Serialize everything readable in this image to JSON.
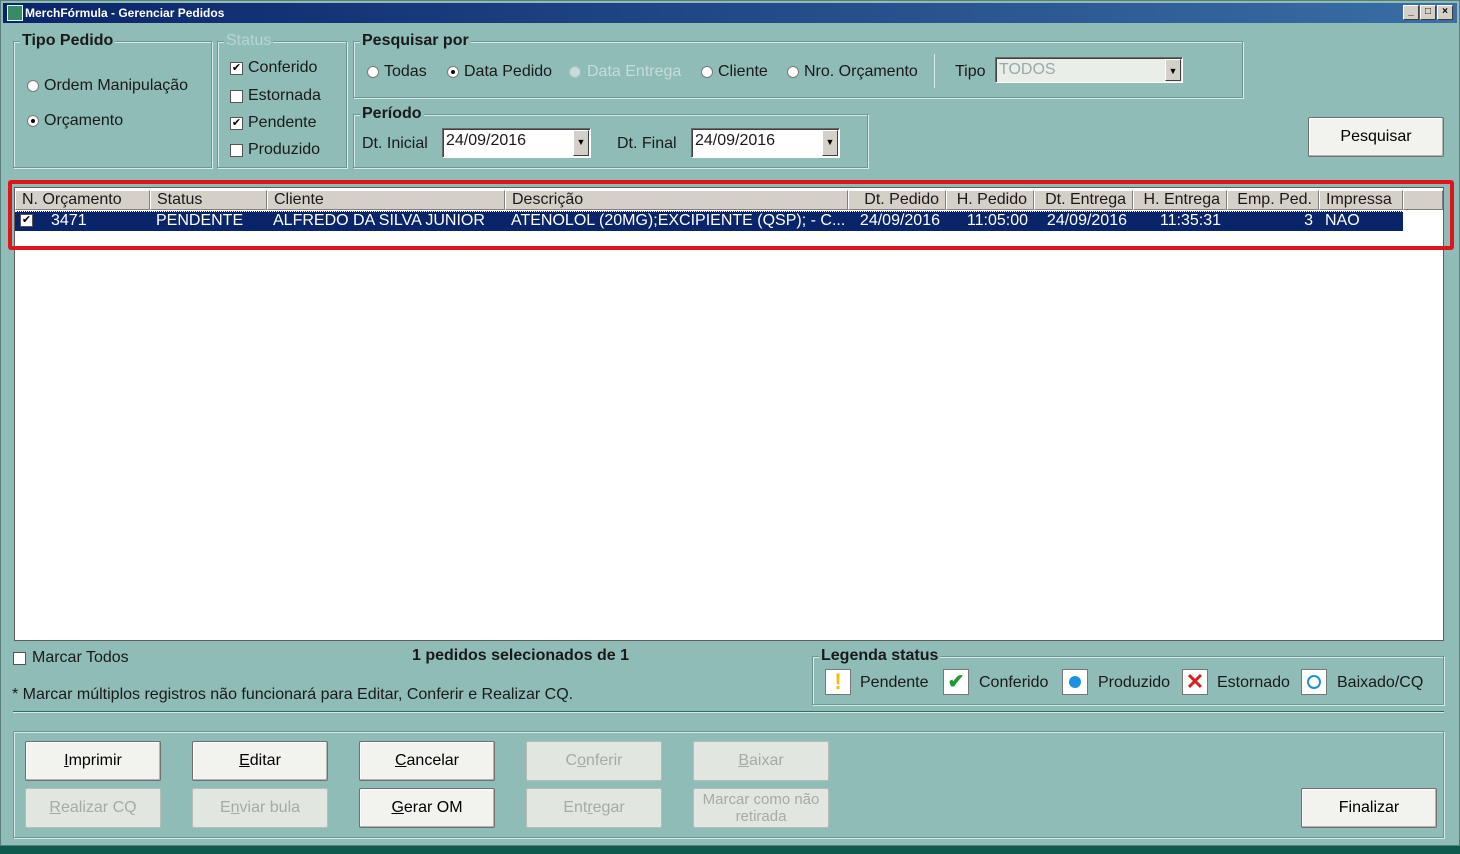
{
  "window": {
    "title": "MerchFórmula - Gerenciar Pedidos",
    "min": "_",
    "max": "□",
    "close": "×"
  },
  "tipo_pedido": {
    "title": "Tipo Pedido",
    "options": [
      {
        "label": "Ordem Manipulação",
        "selected": false
      },
      {
        "label": "Orçamento",
        "selected": true
      }
    ]
  },
  "status": {
    "title": "Status",
    "options": [
      {
        "label": "Conferido",
        "checked": true
      },
      {
        "label": "Estornada",
        "checked": false
      },
      {
        "label": "Pendente",
        "checked": true
      },
      {
        "label": "Produzido",
        "checked": false
      }
    ]
  },
  "pesquisar_por": {
    "title": "Pesquisar por",
    "options": [
      {
        "label": "Todas",
        "selected": false
      },
      {
        "label": "Data Pedido",
        "selected": true
      },
      {
        "label": "Data Entrega",
        "selected": false,
        "disabled": true
      },
      {
        "label": "Cliente",
        "selected": false
      },
      {
        "label": "Nro. Orçamento",
        "selected": false
      }
    ],
    "tipo_label": "Tipo",
    "tipo_value": "TODOS"
  },
  "periodo": {
    "title": "Período",
    "dt_inicial_label": "Dt. Inicial",
    "dt_inicial": "24/09/2016",
    "dt_final_label": "Dt. Final",
    "dt_final": "24/09/2016"
  },
  "pesquisar_button": "Pesquisar",
  "grid": {
    "columns": [
      "N. Orçamento",
      "Status",
      "Cliente",
      "Descrição",
      "Dt. Pedido",
      "H. Pedido",
      "Dt. Entrega",
      "H. Entrega",
      "Emp. Ped.",
      "Impressa"
    ],
    "rows": [
      {
        "checked": true,
        "n_orcamento": "3471",
        "status": "PENDENTE",
        "cliente": "ALFREDO DA SILVA JUNIOR",
        "descricao": "ATENOLOL (20MG);EXCIPIENTE (QSP); -  C...",
        "dt_pedido": "24/09/2016",
        "h_pedido": "11:05:00",
        "dt_entrega": "24/09/2016",
        "h_entrega": "11:35:31",
        "emp_ped": "3",
        "impressa": "NAO"
      }
    ]
  },
  "marcar_todos": "Marcar Todos",
  "selecionados": "1 pedidos selecionados de 1",
  "nota": "* Marcar múltiplos registros não funcionará para Editar, Conferir e Realizar CQ.",
  "legenda": {
    "title": "Legenda status",
    "items": [
      {
        "label": "Pendente",
        "icon": "exclamation-icon",
        "color": "#f0c000"
      },
      {
        "label": "Conferido",
        "icon": "checkmark-icon",
        "color": "#1e9a3a"
      },
      {
        "label": "Produzido",
        "icon": "blue-dot-icon",
        "color": "#1e90e0"
      },
      {
        "label": "Estornado",
        "icon": "red-x-icon",
        "color": "#d81e1e"
      },
      {
        "label": "Baixado/CQ",
        "icon": "blue-ring-icon",
        "color": "#1e90e0"
      }
    ]
  },
  "buttons": {
    "imprimir": {
      "underline": "I",
      "rest": "mprimir"
    },
    "editar": {
      "underline": "E",
      "rest": "ditar"
    },
    "cancelar": {
      "underline": "C",
      "rest": "ancelar"
    },
    "conferir": {
      "pre": "C",
      "underline": "o",
      "rest": "nferir"
    },
    "baixar": {
      "underline": "B",
      "rest": "aixar"
    },
    "realizar_cq": {
      "underline": "R",
      "rest": "ealizar CQ"
    },
    "enviar_bula": {
      "pre": "E",
      "underline": "n",
      "rest": "viar bula"
    },
    "gerar_om": {
      "underline": "G",
      "rest": "erar OM"
    },
    "entregar": {
      "pre": "Ent",
      "underline": "r",
      "rest": "egar"
    },
    "marcar_nao_retirada": {
      "line1": "Marcar como não",
      "line2": "retirada"
    },
    "finalizar": "Finalizar"
  }
}
